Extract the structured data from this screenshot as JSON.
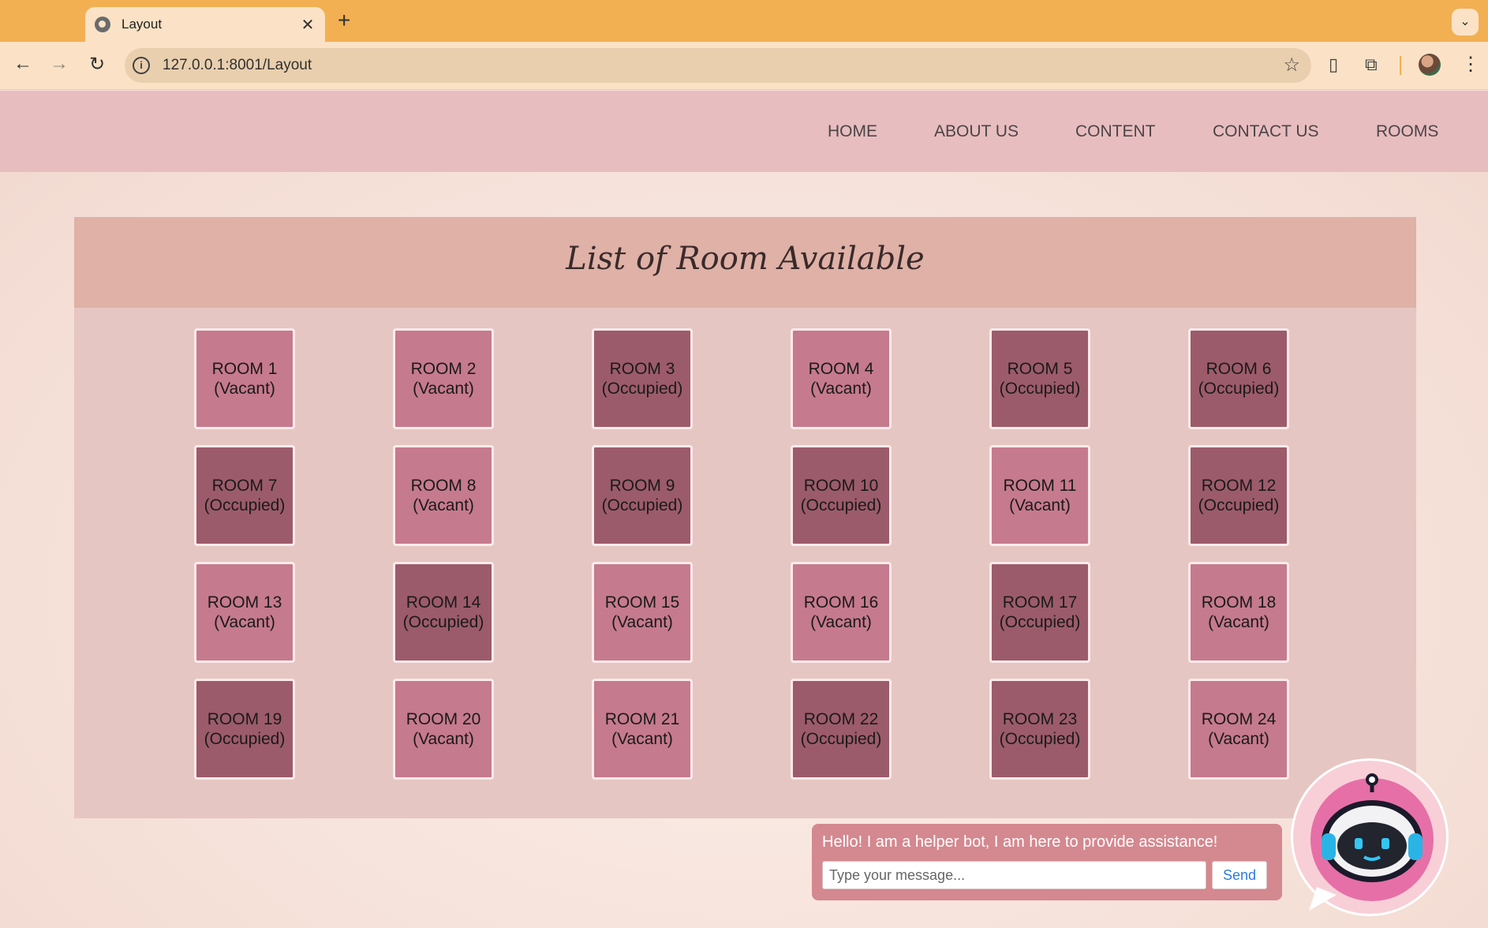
{
  "browser": {
    "tab_title": "Layout",
    "new_tab": "+",
    "tab_close": "✕",
    "url": "127.0.0.1:8001/Layout"
  },
  "nav": {
    "items": [
      "HOME",
      "ABOUT US",
      "CONTENT",
      "CONTACT US",
      "ROOMS"
    ]
  },
  "panel": {
    "title": "List of Room Available"
  },
  "rooms": [
    {
      "name": "ROOM 1",
      "status": "(Vacant)"
    },
    {
      "name": "ROOM 2",
      "status": "(Vacant)"
    },
    {
      "name": "ROOM 3",
      "status": "(Occupied)"
    },
    {
      "name": "ROOM 4",
      "status": "(Vacant)"
    },
    {
      "name": "ROOM 5",
      "status": "(Occupied)"
    },
    {
      "name": "ROOM 6",
      "status": "(Occupied)"
    },
    {
      "name": "ROOM 7",
      "status": "(Occupied)"
    },
    {
      "name": "ROOM 8",
      "status": "(Vacant)"
    },
    {
      "name": "ROOM 9",
      "status": "(Occupied)"
    },
    {
      "name": "ROOM 10",
      "status": "(Occupied)"
    },
    {
      "name": "ROOM 11",
      "status": "(Vacant)"
    },
    {
      "name": "ROOM 12",
      "status": "(Occupied)"
    },
    {
      "name": "ROOM 13",
      "status": "(Vacant)"
    },
    {
      "name": "ROOM 14",
      "status": "(Occupied)"
    },
    {
      "name": "ROOM 15",
      "status": "(Vacant)"
    },
    {
      "name": "ROOM 16",
      "status": "(Vacant)"
    },
    {
      "name": "ROOM 17",
      "status": "(Occupied)"
    },
    {
      "name": "ROOM 18",
      "status": "(Vacant)"
    },
    {
      "name": "ROOM 19",
      "status": "(Occupied)"
    },
    {
      "name": "ROOM 20",
      "status": "(Vacant)"
    },
    {
      "name": "ROOM 21",
      "status": "(Vacant)"
    },
    {
      "name": "ROOM 22",
      "status": "(Occupied)"
    },
    {
      "name": "ROOM 23",
      "status": "(Occupied)"
    },
    {
      "name": "ROOM 24",
      "status": "(Vacant)"
    }
  ],
  "colors": {
    "vacant": "#c67a8d",
    "occupied": "#9c5b6a"
  },
  "chat": {
    "greeting": "Hello! I am a helper bot, I am here to provide assistance!",
    "placeholder": "Type your message...",
    "send_label": "Send",
    "avatar_icon": "robot-icon"
  }
}
